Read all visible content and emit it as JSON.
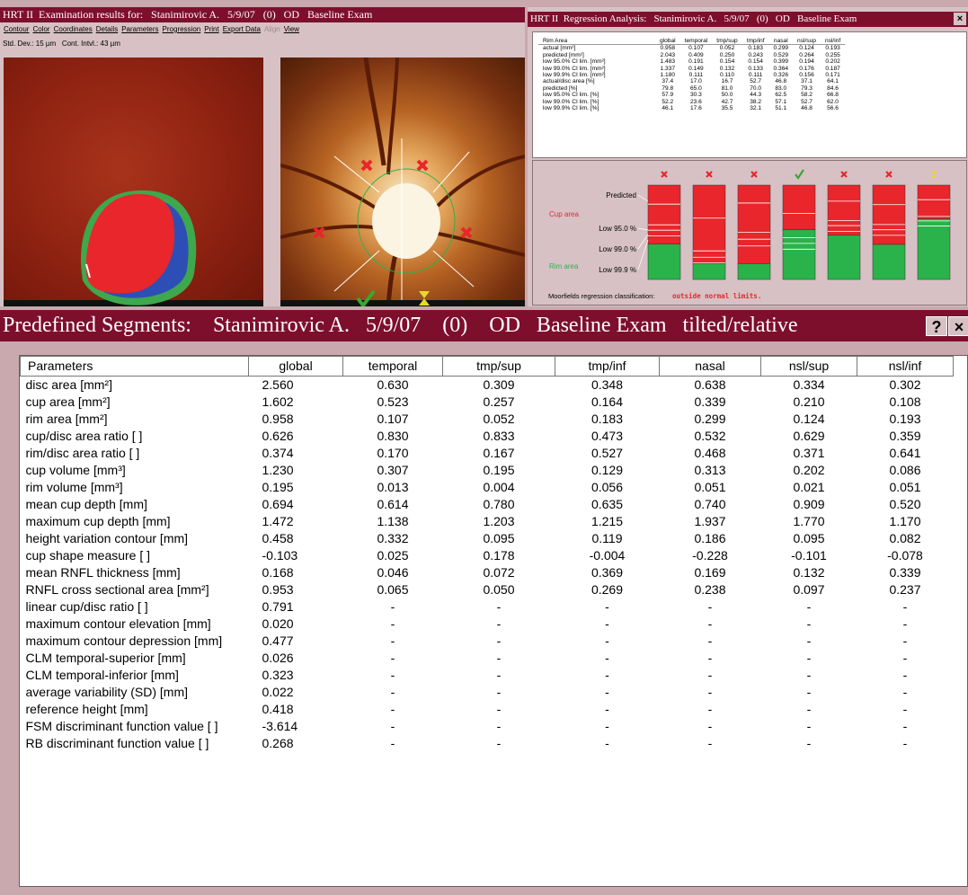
{
  "exam": {
    "title": "HRT II  Examination results for:   Stanimirovic A.   5/9/07   (0)   OD   Baseline Exam",
    "menu": [
      "Contour",
      "Color",
      "Coordinates",
      "Details",
      "Parameters",
      "Progression",
      "Print",
      "Export Data",
      "Align",
      "View"
    ],
    "std_line": "Std. Dev.: 15 µm   Cont. Intvl.: 43 µm"
  },
  "regression": {
    "title": "HRT II  Regression Analysis:   Stanimirovic A.   5/9/07   (0)   OD   Baseline Exam",
    "close": "×",
    "columns": [
      "Rim Area",
      "global",
      "temporal",
      "tmp/sup",
      "tmp/inf",
      "nasal",
      "nsl/sup",
      "nsl/inf"
    ],
    "rows": [
      [
        "actual  [mm²]",
        "0.958",
        "0.107",
        "0.052",
        "0.183",
        "0.299",
        "0.124",
        "0.193"
      ],
      [
        "predicted  [mm²]",
        "2.043",
        "0.409",
        "0.250",
        "0.243",
        "0.529",
        "0.264",
        "0.255"
      ],
      [
        "low 95.0% CI lim.  [mm²]",
        "1.483",
        "0.191",
        "0.154",
        "0.154",
        "0.399",
        "0.194",
        "0.202"
      ],
      [
        "low 99.0% CI lim.  [mm²]",
        "1.337",
        "0.149",
        "0.132",
        "0.133",
        "0.364",
        "0.176",
        "0.187"
      ],
      [
        "low 99.9% CI lim.  [mm²]",
        "1.180",
        "0.111",
        "0.110",
        "0.111",
        "0.326",
        "0.156",
        "0.171"
      ],
      [
        "actual/disc area  [%]",
        "37.4",
        "17.0",
        "16.7",
        "52.7",
        "46.8",
        "37.1",
        "64.1"
      ],
      [
        "predicted  [%]",
        "79.8",
        "65.0",
        "81.0",
        "70.0",
        "83.0",
        "79.3",
        "84.6"
      ],
      [
        "low 95.0% CI lim.  [%]",
        "57.9",
        "30.3",
        "50.0",
        "44.3",
        "62.5",
        "58.2",
        "66.8"
      ],
      [
        "low 99.0% CI lim.  [%]",
        "52.2",
        "23.6",
        "42.7",
        "38.2",
        "57.1",
        "52.7",
        "62.0"
      ],
      [
        "low 99.9% CI lim.  [%]",
        "46.1",
        "17.6",
        "35.5",
        "32.1",
        "51.1",
        "46.8",
        "56.6"
      ]
    ],
    "chart": {
      "labels": {
        "predicted": "Predicted",
        "cup_area": "Cup area",
        "low95": "Low 95.0 %",
        "low99": "Low 99.0 %",
        "rim_area": "Rim area",
        "low999": "Low 99.9 %"
      },
      "classification_label": "Moorfields regression classification:",
      "classification_value": "outside normal limits.",
      "status_marks": [
        "cross",
        "cross",
        "cross",
        "check",
        "cross",
        "cross",
        "hourglass"
      ],
      "colors": {
        "cup": "#e8262b",
        "rim": "#2ab34a",
        "cross": "#e8262b",
        "check": "#3aa632",
        "hourglass": "#e8d82a"
      }
    }
  },
  "segments": {
    "title": "Predefined Segments:    Stanimirovic A.   5/9/07    (0)    OD   Baseline Exam   tilted/relative",
    "help": "?",
    "close": "×",
    "columns": [
      "Parameters",
      "global",
      "temporal",
      "tmp/sup",
      "tmp/inf",
      "nasal",
      "nsl/sup",
      "nsl/inf"
    ],
    "rows": [
      [
        "disc area [mm²]",
        "2.560",
        "0.630",
        "0.309",
        "0.348",
        "0.638",
        "0.334",
        "0.302"
      ],
      [
        "cup area [mm²]",
        "1.602",
        "0.523",
        "0.257",
        "0.164",
        "0.339",
        "0.210",
        "0.108"
      ],
      [
        "rim area [mm²]",
        "0.958",
        "0.107",
        "0.052",
        "0.183",
        "0.299",
        "0.124",
        "0.193"
      ],
      [
        "cup/disc area ratio [ ]",
        "0.626",
        "0.830",
        "0.833",
        "0.473",
        "0.532",
        "0.629",
        "0.359"
      ],
      [
        "rim/disc area ratio [ ]",
        "0.374",
        "0.170",
        "0.167",
        "0.527",
        "0.468",
        "0.371",
        "0.641"
      ],
      [
        "cup volume [mm³]",
        "1.230",
        "0.307",
        "0.195",
        "0.129",
        "0.313",
        "0.202",
        "0.086"
      ],
      [
        "rim volume [mm³]",
        "0.195",
        "0.013",
        "0.004",
        "0.056",
        "0.051",
        "0.021",
        "0.051"
      ],
      [
        "mean cup depth [mm]",
        "0.694",
        "0.614",
        "0.780",
        "0.635",
        "0.740",
        "0.909",
        "0.520"
      ],
      [
        "maximum cup depth [mm]",
        "1.472",
        "1.138",
        "1.203",
        "1.215",
        "1.937",
        "1.770",
        "1.170"
      ],
      [
        "height variation contour [mm]",
        "0.458",
        "0.332",
        "0.095",
        "0.119",
        "0.186",
        "0.095",
        "0.082"
      ],
      [
        "cup shape measure [ ]",
        "-0.103",
        "0.025",
        "0.178",
        "-0.004",
        "-0.228",
        "-0.101",
        "-0.078"
      ],
      [
        "mean RNFL thickness [mm]",
        "0.168",
        "0.046",
        "0.072",
        "0.369",
        "0.169",
        "0.132",
        "0.339"
      ],
      [
        "RNFL cross sectional area [mm²]",
        "0.953",
        "0.065",
        "0.050",
        "0.269",
        "0.238",
        "0.097",
        "0.237"
      ],
      [
        "linear cup/disc ratio [ ]",
        "0.791",
        "-",
        "-",
        "-",
        "-",
        "-",
        "-"
      ],
      [
        "maximum contour elevation [mm]",
        "0.020",
        "-",
        "-",
        "-",
        "-",
        "-",
        "-"
      ],
      [
        "maximum contour depression [mm]",
        "0.477",
        "-",
        "-",
        "-",
        "-",
        "-",
        "-"
      ],
      [
        "CLM temporal-superior [mm]",
        "0.026",
        "-",
        "-",
        "-",
        "-",
        "-",
        "-"
      ],
      [
        "CLM temporal-inferior [mm]",
        "0.323",
        "-",
        "-",
        "-",
        "-",
        "-",
        "-"
      ],
      [
        "average variability (SD) [mm]",
        "0.022",
        "-",
        "-",
        "-",
        "-",
        "-",
        "-"
      ],
      [
        "reference height [mm]",
        "0.418",
        "-",
        "-",
        "-",
        "-",
        "-",
        "-"
      ],
      [
        "FSM discriminant function value [ ]",
        "-3.614",
        "-",
        "-",
        "-",
        "-",
        "-",
        "-"
      ],
      [
        "RB discriminant function value [ ]",
        "0.268",
        "-",
        "-",
        "-",
        "-",
        "-",
        "-"
      ]
    ]
  }
}
